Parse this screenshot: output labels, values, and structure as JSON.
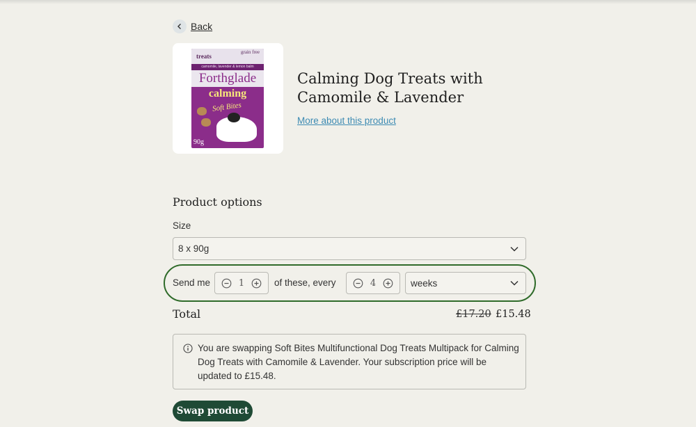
{
  "nav": {
    "back_label": "Back"
  },
  "product": {
    "title": "Calming Dog Treats with Camomile & Lavender",
    "more_link": "More about this product",
    "image": {
      "top_label": "treats",
      "badge": "grain free",
      "strip": "camomile, lavender & lemon balm",
      "brand": "Forthglade",
      "headline": "calming",
      "sub": "Soft Bites",
      "weight": "90g"
    }
  },
  "options": {
    "heading": "Product options",
    "size_label": "Size",
    "size_value": "8 x 90g",
    "frequency": {
      "send_label": "Send me",
      "quantity": "1",
      "of_label": "of these, every",
      "interval": "4",
      "unit": "weeks"
    }
  },
  "total": {
    "label": "Total",
    "old_price": "£17.20",
    "new_price": "£15.48"
  },
  "notice": {
    "text": "You are swapping Soft Bites Multifunctional Dog Treats Multipack for Calming Dog Treats with Camomile & Lavender. Your subscription price will be updated to £15.48."
  },
  "actions": {
    "swap_label": "Swap product"
  },
  "colors": {
    "accent": "#1f4a35",
    "link": "#3d8bb3",
    "highlight_ring": "#2f6b2a",
    "background": "#f1f0ea"
  }
}
